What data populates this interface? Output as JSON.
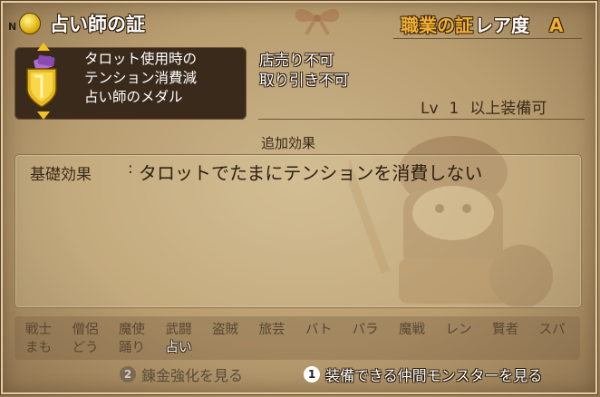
{
  "header": {
    "badge": "N",
    "icon": "coin-icon",
    "title": "占い師の証",
    "category": "職業の証",
    "rarity_label": "レア度",
    "rarity_grade": "A"
  },
  "item": {
    "icon": "medal-icon",
    "description": [
      "タロット使用時の",
      "テンション消費減",
      "占い師のメダル"
    ],
    "trade": [
      "店売り不可",
      "取り引き不可"
    ],
    "level_prefix": "Lv",
    "level": "1",
    "level_suffix": "以上装備可"
  },
  "effects": {
    "title": "追加効果",
    "label": "基礎効果",
    "separator": ":",
    "text": "タロットでたまにテンションを消費しない"
  },
  "jobs": {
    "row1": [
      {
        "name": "戦士",
        "active": false
      },
      {
        "name": "僧侶",
        "active": false
      },
      {
        "name": "魔使",
        "active": false
      },
      {
        "name": "武闘",
        "active": false
      },
      {
        "name": "盗賊",
        "active": false
      },
      {
        "name": "旅芸",
        "active": false
      },
      {
        "name": "バト",
        "active": false
      },
      {
        "name": "パラ",
        "active": false
      },
      {
        "name": "魔戦",
        "active": false
      },
      {
        "name": "レン",
        "active": false
      },
      {
        "name": "賢者",
        "active": false
      },
      {
        "name": "スパ",
        "active": false
      }
    ],
    "row2": [
      {
        "name": "まも",
        "active": false
      },
      {
        "name": "どう",
        "active": false
      },
      {
        "name": "踊り",
        "active": false
      },
      {
        "name": "占い",
        "active": true
      }
    ]
  },
  "footer": {
    "btn2_num": "2",
    "btn2_label": "錬金強化を見る",
    "btn1_num": "1",
    "btn1_label": "装備できる仲間モンスターを見る"
  },
  "colors": {
    "accent": "#f0b036",
    "parchment": "#c2a87c",
    "dark_panel": "#3a2a1c"
  }
}
